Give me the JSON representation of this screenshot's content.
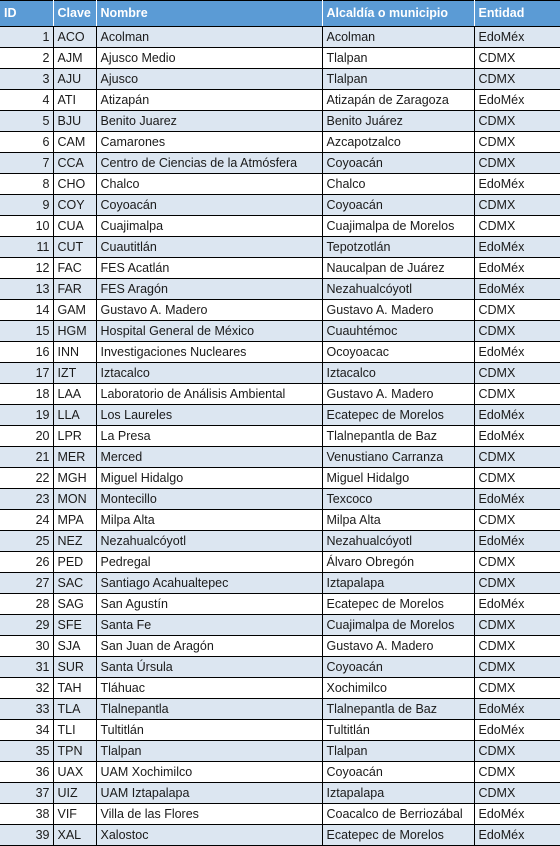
{
  "table": {
    "columns": [
      {
        "key": "id",
        "label": "ID"
      },
      {
        "key": "clave",
        "label": "Clave"
      },
      {
        "key": "nombre",
        "label": "Nombre"
      },
      {
        "key": "alcaldia",
        "label": "Alcaldía o municipio"
      },
      {
        "key": "entidad",
        "label": "Entidad"
      }
    ],
    "colors": {
      "header_background": "#5b9bd5",
      "header_text": "#ffffff",
      "row_odd_background": "#dce6f1",
      "row_even_background": "#ffffff",
      "border": "#000000",
      "body_text": "#1a1a1a"
    },
    "row_count": 39,
    "rows": [
      {
        "id": "1",
        "clave": "ACO",
        "nombre": "Acolman",
        "alcaldia": "Acolman",
        "entidad": "EdoMéx"
      },
      {
        "id": "2",
        "clave": "AJM",
        "nombre": "Ajusco Medio",
        "alcaldia": "Tlalpan",
        "entidad": "CDMX"
      },
      {
        "id": "3",
        "clave": "AJU",
        "nombre": "Ajusco",
        "alcaldia": "Tlalpan",
        "entidad": "CDMX"
      },
      {
        "id": "4",
        "clave": "ATI",
        "nombre": "Atizapán",
        "alcaldia": "Atizapán de Zaragoza",
        "entidad": "EdoMéx"
      },
      {
        "id": "5",
        "clave": "BJU",
        "nombre": "Benito Juarez",
        "alcaldia": "Benito Juárez",
        "entidad": "CDMX"
      },
      {
        "id": "6",
        "clave": "CAM",
        "nombre": "Camarones",
        "alcaldia": "Azcapotzalco",
        "entidad": "CDMX"
      },
      {
        "id": "7",
        "clave": "CCA",
        "nombre": "Centro de Ciencias de la Atmósfera",
        "alcaldia": "Coyoacán",
        "entidad": "CDMX"
      },
      {
        "id": "8",
        "clave": "CHO",
        "nombre": "Chalco",
        "alcaldia": "Chalco",
        "entidad": "EdoMéx"
      },
      {
        "id": "9",
        "clave": "COY",
        "nombre": "Coyoacán",
        "alcaldia": "Coyoacán",
        "entidad": "CDMX"
      },
      {
        "id": "10",
        "clave": "CUA",
        "nombre": "Cuajimalpa",
        "alcaldia": "Cuajimalpa de Morelos",
        "entidad": "CDMX"
      },
      {
        "id": "11",
        "clave": "CUT",
        "nombre": "Cuautitlán",
        "alcaldia": "Tepotzotlán",
        "entidad": "EdoMéx"
      },
      {
        "id": "12",
        "clave": "FAC",
        "nombre": "FES Acatlán",
        "alcaldia": "Naucalpan de Juárez",
        "entidad": "EdoMéx"
      },
      {
        "id": "13",
        "clave": "FAR",
        "nombre": "FES Aragón",
        "alcaldia": "Nezahualcóyotl",
        "entidad": "EdoMéx"
      },
      {
        "id": "14",
        "clave": "GAM",
        "nombre": "Gustavo A. Madero",
        "alcaldia": "Gustavo A. Madero",
        "entidad": "CDMX"
      },
      {
        "id": "15",
        "clave": "HGM",
        "nombre": "Hospital General de México",
        "alcaldia": "Cuauhtémoc",
        "entidad": "CDMX"
      },
      {
        "id": "16",
        "clave": "INN",
        "nombre": "Investigaciones Nucleares",
        "alcaldia": "Ocoyoacac",
        "entidad": "EdoMéx"
      },
      {
        "id": "17",
        "clave": "IZT",
        "nombre": "Iztacalco",
        "alcaldia": "Iztacalco",
        "entidad": "CDMX"
      },
      {
        "id": "18",
        "clave": "LAA",
        "nombre": "Laboratorio de Análisis Ambiental",
        "alcaldia": "Gustavo A. Madero",
        "entidad": "CDMX"
      },
      {
        "id": "19",
        "clave": "LLA",
        "nombre": "Los Laureles",
        "alcaldia": "Ecatepec de Morelos",
        "entidad": "EdoMéx"
      },
      {
        "id": "20",
        "clave": "LPR",
        "nombre": "La Presa",
        "alcaldia": "Tlalnepantla de Baz",
        "entidad": "EdoMéx"
      },
      {
        "id": "21",
        "clave": "MER",
        "nombre": "Merced",
        "alcaldia": "Venustiano Carranza",
        "entidad": "CDMX"
      },
      {
        "id": "22",
        "clave": "MGH",
        "nombre": "Miguel Hidalgo",
        "alcaldia": "Miguel Hidalgo",
        "entidad": "CDMX"
      },
      {
        "id": "23",
        "clave": "MON",
        "nombre": "Montecillo",
        "alcaldia": "Texcoco",
        "entidad": "EdoMéx"
      },
      {
        "id": "24",
        "clave": "MPA",
        "nombre": "Milpa Alta",
        "alcaldia": "Milpa Alta",
        "entidad": "CDMX"
      },
      {
        "id": "25",
        "clave": "NEZ",
        "nombre": "Nezahualcóyotl",
        "alcaldia": "Nezahualcóyotl",
        "entidad": "EdoMéx"
      },
      {
        "id": "26",
        "clave": "PED",
        "nombre": "Pedregal",
        "alcaldia": "Álvaro Obregón",
        "entidad": "CDMX"
      },
      {
        "id": "27",
        "clave": "SAC",
        "nombre": "Santiago Acahualtepec",
        "alcaldia": "Iztapalapa",
        "entidad": "CDMX"
      },
      {
        "id": "28",
        "clave": "SAG",
        "nombre": "San Agustín",
        "alcaldia": "Ecatepec de Morelos",
        "entidad": "EdoMéx"
      },
      {
        "id": "29",
        "clave": "SFE",
        "nombre": "Santa Fe",
        "alcaldia": "Cuajimalpa de Morelos",
        "entidad": "CDMX"
      },
      {
        "id": "30",
        "clave": "SJA",
        "nombre": "San Juan de Aragón",
        "alcaldia": "Gustavo A. Madero",
        "entidad": "CDMX"
      },
      {
        "id": "31",
        "clave": "SUR",
        "nombre": "Santa Úrsula",
        "alcaldia": "Coyoacán",
        "entidad": "CDMX"
      },
      {
        "id": "32",
        "clave": "TAH",
        "nombre": "Tláhuac",
        "alcaldia": "Xochimilco",
        "entidad": "CDMX"
      },
      {
        "id": "33",
        "clave": "TLA",
        "nombre": "Tlalnepantla",
        "alcaldia": "Tlalnepantla de Baz",
        "entidad": "EdoMéx"
      },
      {
        "id": "34",
        "clave": "TLI",
        "nombre": "Tultitlán",
        "alcaldia": "Tultitlán",
        "entidad": "EdoMéx"
      },
      {
        "id": "35",
        "clave": "TPN",
        "nombre": "Tlalpan",
        "alcaldia": "Tlalpan",
        "entidad": "CDMX"
      },
      {
        "id": "36",
        "clave": "UAX",
        "nombre": "UAM Xochimilco",
        "alcaldia": "Coyoacán",
        "entidad": "CDMX"
      },
      {
        "id": "37",
        "clave": "UIZ",
        "nombre": "UAM Iztapalapa",
        "alcaldia": "Iztapalapa",
        "entidad": "CDMX"
      },
      {
        "id": "38",
        "clave": "VIF",
        "nombre": "Villa de las Flores",
        "alcaldia": "Coacalco de Berriozábal",
        "entidad": "EdoMéx"
      },
      {
        "id": "39",
        "clave": "XAL",
        "nombre": "Xalostoc",
        "alcaldia": "Ecatepec de Morelos",
        "entidad": "EdoMéx"
      }
    ]
  }
}
